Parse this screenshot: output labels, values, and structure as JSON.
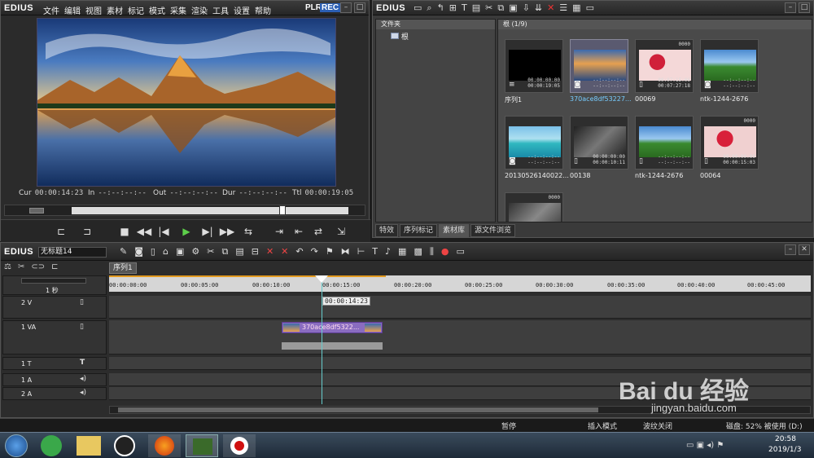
{
  "player": {
    "logo": "EDIUS",
    "menu": [
      "文件",
      "编辑",
      "视图",
      "素材",
      "标记",
      "模式",
      "采集",
      "渲染",
      "工具",
      "设置",
      "帮助"
    ],
    "plr": "PLR",
    "rec": "REC",
    "cur_label": "Cur",
    "cur": "00:00:14:23",
    "in_label": "In",
    "in": "--:--:--:--",
    "out_label": "Out",
    "out": "--:--:--:--",
    "dur_label": "Dur",
    "dur": "--:--:--:--",
    "ttl_label": "Ttl",
    "ttl": "00:00:19:05"
  },
  "bin": {
    "logo": "EDIUS",
    "folder_header": "文件夹",
    "root": "根",
    "bin_header": "根 (1/9)",
    "clips": [
      {
        "name": "序列1",
        "tc_top": "",
        "tc1": "00:00:00:00",
        "tc2": "00:00:19:05",
        "type": "sequence"
      },
      {
        "name": "370ace8df53227...",
        "tc_top": "",
        "tc1": "--:--:--:--",
        "tc2": "--:--:--:--",
        "type": "image",
        "selected": true
      },
      {
        "name": "00069",
        "tc_top": "0000",
        "tc1": "00:07:15:06",
        "tc2": "00:07:27:18",
        "type": "video"
      },
      {
        "name": "ntk-1244-2676",
        "tc_top": "",
        "tc1": "--:--:--:--",
        "tc2": "--:--:--:--",
        "type": "image"
      },
      {
        "name": "20130526140022...",
        "tc_top": "",
        "tc1": "--:--:--:--",
        "tc2": "--:--:--:--",
        "type": "image"
      },
      {
        "name": "00138",
        "tc_top": "",
        "tc1": "00:00:00:00",
        "tc2": "00:00:10:11",
        "type": "video"
      },
      {
        "name": "ntk-1244-2676",
        "tc_top": "",
        "tc1": "--:--:--:--",
        "tc2": "--:--:--:--",
        "type": "video"
      },
      {
        "name": "00064",
        "tc_top": "0000",
        "tc1": "00:00:00:00",
        "tc2": "00:00:15:03",
        "type": "video"
      },
      {
        "name": "",
        "tc_top": "0000",
        "tc1": "",
        "tc2": "",
        "type": "video"
      }
    ],
    "tabs": [
      "特效",
      "序列标记",
      "素材库",
      "源文件浏览"
    ]
  },
  "timeline": {
    "logo": "EDIUS",
    "project": "无标题14",
    "sequence_tab": "序列1",
    "scale": "1 秒",
    "ruler": [
      "00:00:00:00",
      "00:00:05:00",
      "00:00:10:00",
      "00:00:15:00",
      "00:00:20:00",
      "00:00:25:00",
      "00:00:30:00",
      "00:00:35:00",
      "00:00:40:00",
      "00:00:45:00"
    ],
    "cursor_tc": "00:00:14:23",
    "tracks": [
      {
        "name": "2 V"
      },
      {
        "name": "1 VA"
      },
      {
        "name": "1 T"
      },
      {
        "name": "1 A"
      },
      {
        "name": "2 A"
      }
    ],
    "clip_label": "370ace8df5322..."
  },
  "status": {
    "pause": "暂停",
    "mode": "插入模式",
    "ripple": "波纹关闭",
    "disk": "磁盘: 52% 被使用 (D:)"
  },
  "taskbar": {
    "time": "20:58",
    "date": "2019/1/3"
  },
  "watermark": {
    "text": "Bai du 经验",
    "url": "jingyan.baidu.com"
  }
}
